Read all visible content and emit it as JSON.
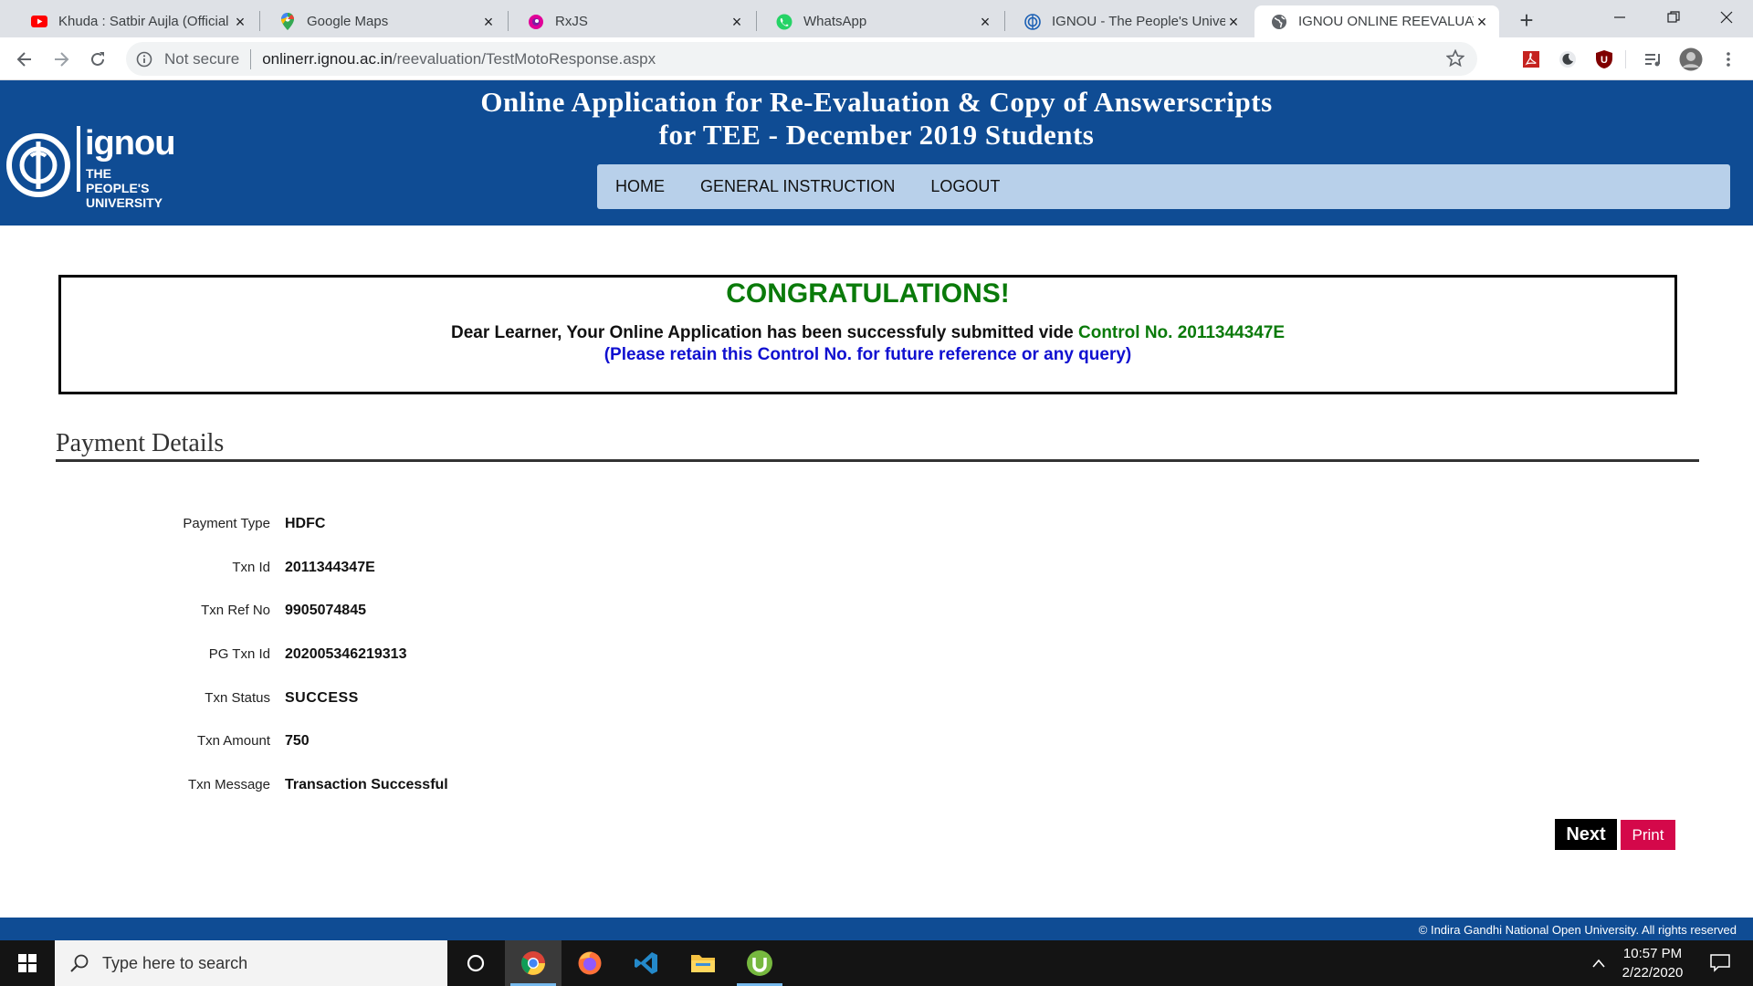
{
  "browser": {
    "tabs": [
      {
        "title": "Khuda : Satbir Aujla (Official S",
        "favicon": "youtube-icon"
      },
      {
        "title": "Google Maps",
        "favicon": "maps-pin-icon"
      },
      {
        "title": "RxJS",
        "favicon": "rxjs-icon"
      },
      {
        "title": "WhatsApp",
        "favicon": "whatsapp-icon"
      },
      {
        "title": "IGNOU - The People's Univer",
        "favicon": "ignou-icon"
      },
      {
        "title": "IGNOU ONLINE REEVALUATIO",
        "favicon": "globe-icon",
        "active": true
      }
    ],
    "security": "Not secure",
    "url_host": "onlinerr.ignou.ac.in",
    "url_path": "/reevaluation/TestMotoResponse.aspx"
  },
  "header": {
    "title_line1": "Online Application for Re-Evaluation & Copy of Answerscripts",
    "title_line2": "for TEE - December 2019 Students",
    "logo_word": "ignou",
    "logo_line1": "THE PEOPLE'S",
    "logo_line2": "UNIVERSITY",
    "menu": [
      "HOME",
      "GENERAL INSTRUCTION",
      "LOGOUT"
    ]
  },
  "congrats": {
    "heading": "CONGRATULATIONS!",
    "message": "Dear Learner, Your Online Application has been successfuly submitted vide ",
    "control": "Control No. 2011344347E",
    "retain": "(Please retain this Control No. for future reference or any query)"
  },
  "payment": {
    "title": "Payment Details",
    "rows": [
      {
        "label": "Payment Type",
        "value": "HDFC"
      },
      {
        "label": "Txn Id",
        "value": "2011344347E"
      },
      {
        "label": "Txn Ref No",
        "value": "9905074845"
      },
      {
        "label": "PG Txn Id",
        "value": "202005346219313"
      },
      {
        "label": "Txn Status",
        "value": "SUCCESS"
      },
      {
        "label": "Txn Amount",
        "value": "750"
      },
      {
        "label": "Txn Message",
        "value": "Transaction Successful"
      }
    ],
    "next_label": "Next",
    "print_label": "Print"
  },
  "footer": {
    "text": "© Indira Gandhi National Open University. All rights reserved"
  },
  "taskbar": {
    "search_placeholder": "Type here to search",
    "time": "10:57 PM",
    "date": "2/22/2020"
  },
  "colors": {
    "header_blue": "#0f4c94",
    "menu_bg": "#b8d0ea",
    "success_green": "#0a7a0a",
    "retain_blue": "#1010d0",
    "print_pink": "#d4084a"
  }
}
